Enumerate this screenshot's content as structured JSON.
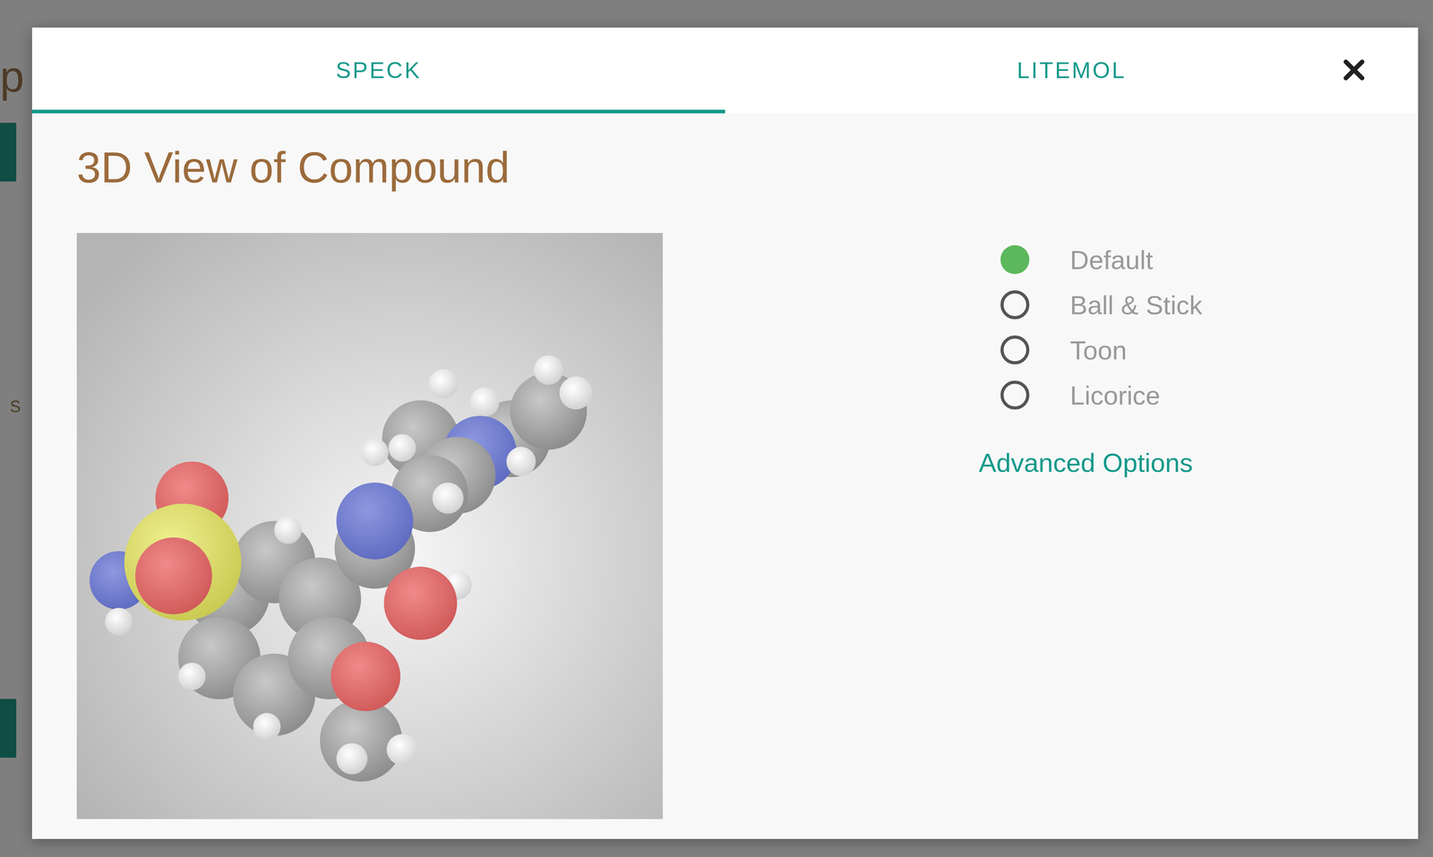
{
  "page_behind": {
    "title_fragment": "p",
    "structure_label": "S"
  },
  "tabs": [
    {
      "label": "SPECK",
      "selected": true
    },
    {
      "label": "LITEMOL",
      "selected": false
    }
  ],
  "title": "3D View of Compound",
  "view_modes": [
    {
      "label": "Default",
      "selected": true
    },
    {
      "label": "Ball & Stick",
      "selected": false
    },
    {
      "label": "Toon",
      "selected": false
    },
    {
      "label": "Licorice",
      "selected": false
    }
  ],
  "advanced_options": "Advanced Options"
}
